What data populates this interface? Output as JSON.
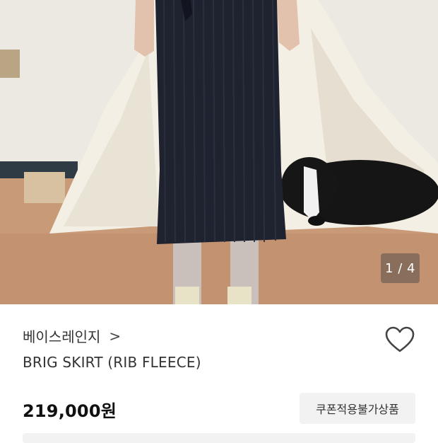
{
  "gallery": {
    "image_alt": "product-photo-ribbed-navy-skirt",
    "counter": "1 / 4"
  },
  "product": {
    "brand": "베이스레인지",
    "brand_chevron": ">",
    "title": "BRIG SKIRT (RIB FLEECE)",
    "price": "219,000원",
    "coupon_badge": "쿠폰적용불가상품",
    "wishlist_icon": "heart-outline-icon"
  },
  "colors": {
    "text": "#333333",
    "price": "#111111",
    "badge_bg": "#f2f2f2",
    "skirt": "#1f2330"
  }
}
